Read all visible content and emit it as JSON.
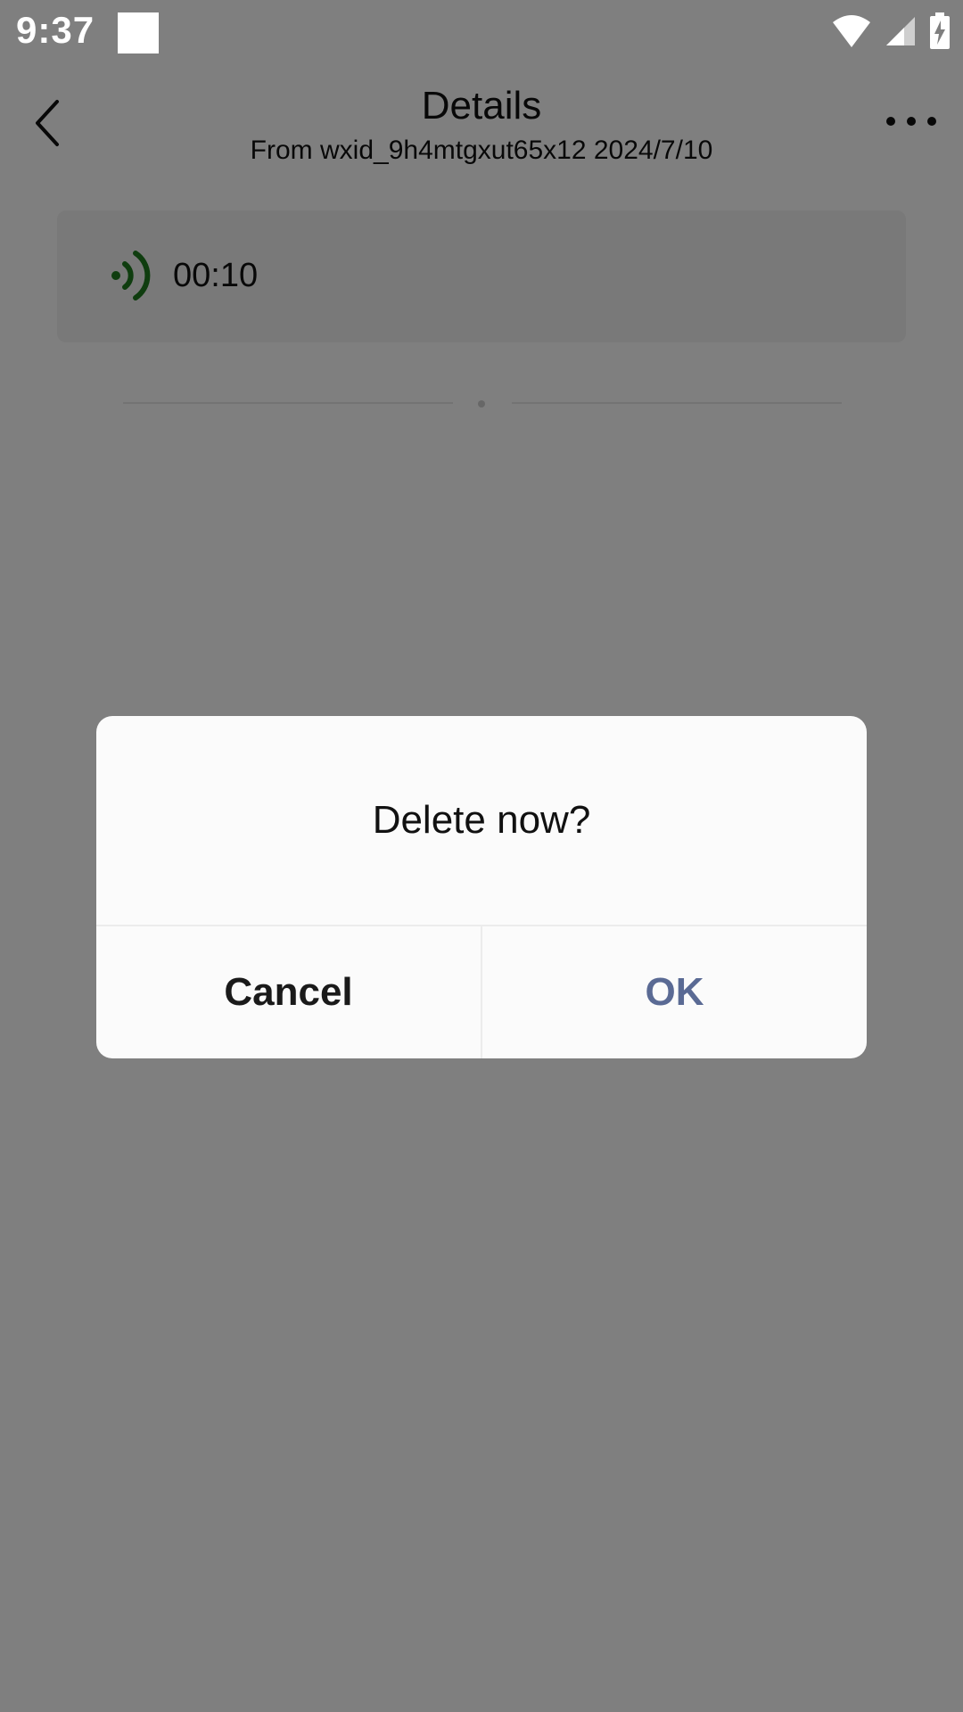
{
  "status_bar": {
    "time": "9:37",
    "icons": [
      "wifi-icon",
      "cellular-signal-icon",
      "battery-charging-icon"
    ]
  },
  "header": {
    "title": "Details",
    "subtitle": "From wxid_9h4mtgxut65x12 2024/7/10",
    "back_icon": "chevron-left-icon",
    "more_icon": "more-horizontal-icon"
  },
  "voice_message": {
    "icon": "voice-wave-icon",
    "duration": "00:10",
    "icon_color": "#1f7a1f"
  },
  "dialog": {
    "message": "Delete now?",
    "cancel_label": "Cancel",
    "ok_label": "OK",
    "ok_color": "#5a6a94"
  }
}
